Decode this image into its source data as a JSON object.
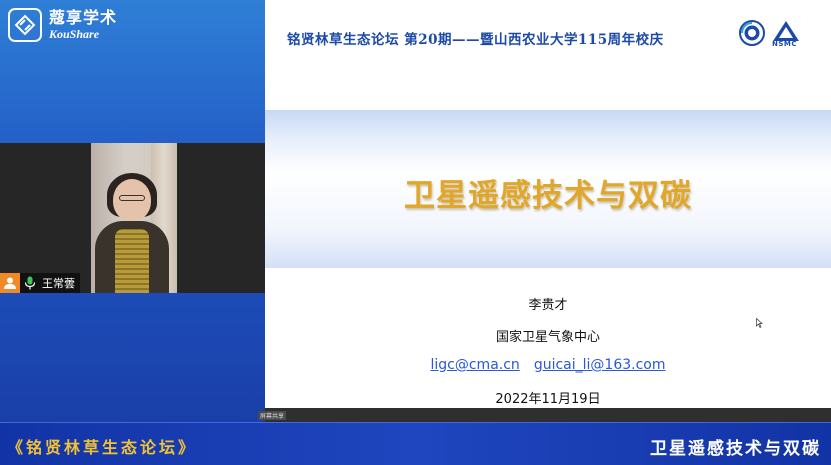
{
  "brand": {
    "name_cn": "蔻享学术",
    "name_en": "KouShare"
  },
  "participant": {
    "name": "王常蕓"
  },
  "slide": {
    "header_title": "铭贤林草生态论坛 第20期——暨山西农业大学115周年校庆",
    "org_logos": [
      "cma-logo",
      "nsmc-logo"
    ],
    "nsmc_label": "NSMC",
    "main_title": "卫星遥感技术与双碳",
    "author": "李贵才",
    "organization": "国家卫星气象中心",
    "emails": [
      "ligc@cma.cn",
      "guicai_li@163.com"
    ],
    "date": "2022年11月19日"
  },
  "share_badge": "屏幕共享",
  "banner": {
    "left_text": "《铭贤林草生态论坛》",
    "right_text": "卫星遥感技术与双碳"
  },
  "colors": {
    "brand_blue": "#1f56c3",
    "title_gold": "#e0a72a",
    "header_blue": "#1c4aa7",
    "link_blue": "#2b58d6",
    "banner_gold": "#f1c233"
  }
}
